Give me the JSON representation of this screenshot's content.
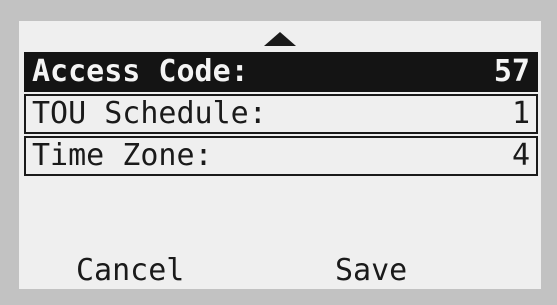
{
  "menu": {
    "items": [
      {
        "label": "Access Code:",
        "value": "57",
        "selected": true
      },
      {
        "label": "TOU Schedule:",
        "value": "1",
        "selected": false
      },
      {
        "label": "Time Zone:",
        "value": "4",
        "selected": false
      }
    ]
  },
  "softkeys": {
    "left_label": "Cancel",
    "right_label": "Save"
  },
  "icons": {
    "scroll_up": "triangle-up-icon"
  },
  "colors": {
    "screen_background": "#efefef",
    "foreground": "#1a1a1a",
    "bezel": "#c2c2c2"
  }
}
